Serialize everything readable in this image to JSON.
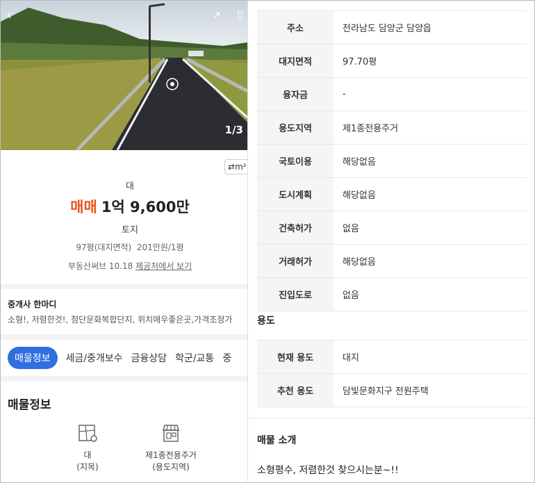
{
  "photo": {
    "counter": "1/3"
  },
  "unit_toggle": "m²",
  "summary": {
    "category": "대",
    "deal_type": "매매",
    "price": "1억 9,600만",
    "property_type": "토지",
    "meta": "97평(대지면적)  201만원/1평",
    "source_prefix": "부동산써브 10.18",
    "source_link": "제공처에서 보기"
  },
  "comment": {
    "title": "중개사 한마디",
    "text": "소형!, 저렴한것!, 첨단문화복합단지, 위치매우좋은곳,가격조정가"
  },
  "tabs": [
    "매물정보",
    "세금/중개보수",
    "금융상담",
    "학군/교통",
    "중"
  ],
  "section_title": "매물정보",
  "info_icons": [
    {
      "label1": "대",
      "label2": "(지목)"
    },
    {
      "label1": "제1종전용주거",
      "label2": "(용도지역)"
    }
  ],
  "info_rows": [
    {
      "k": "주소",
      "v": "전라남도 담양군 담양읍"
    },
    {
      "k": "대지면적",
      "v": "97.70평"
    },
    {
      "k": "융자금",
      "v": "-"
    },
    {
      "k": "용도지역",
      "v": "제1종전용주거"
    },
    {
      "k": "국토이용",
      "v": "해당없음"
    },
    {
      "k": "도시계획",
      "v": "해당없음"
    },
    {
      "k": "건축허가",
      "v": "없음"
    },
    {
      "k": "거래허가",
      "v": "해당없음"
    },
    {
      "k": "진입도로",
      "v": "없음"
    }
  ],
  "usage": {
    "title": "용도",
    "rows": [
      {
        "k": "현재 용도",
        "v": "대지"
      },
      {
        "k": "추천 용도",
        "v": "담빛문화지구 전원주택"
      }
    ]
  },
  "intro": {
    "title": "매물 소개",
    "text": "소형평수, 저렴한것 찾으시는분~!!"
  },
  "colors": {
    "accent": "#e8541c",
    "tab_active": "#2f6fe0"
  }
}
